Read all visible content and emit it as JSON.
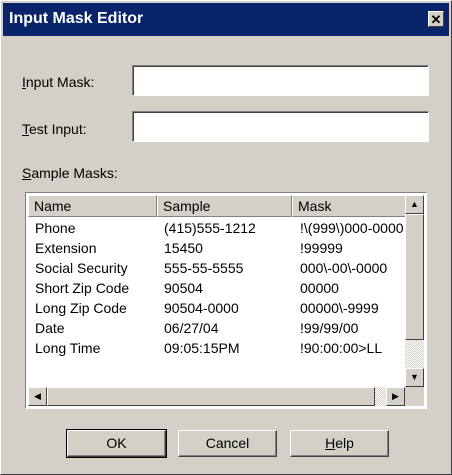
{
  "window": {
    "title": "Input Mask Editor",
    "close_glyph": "✕"
  },
  "form": {
    "input_mask_label_key": "I",
    "input_mask_label_rest": "nput Mask:",
    "input_mask_value": "",
    "test_input_label_key": "T",
    "test_input_label_rest": "est Input:",
    "test_input_value": "",
    "sample_masks_label_key": "S",
    "sample_masks_label_rest": "ample Masks:"
  },
  "table": {
    "columns": [
      "Name",
      "Sample",
      "Mask"
    ],
    "rows": [
      [
        "Phone",
        "(415)555-1212",
        "!\\(999\\)000-0000"
      ],
      [
        "Extension",
        "15450",
        "!99999"
      ],
      [
        "Social Security",
        "555-55-5555",
        "000\\-00\\-0000"
      ],
      [
        "Short Zip Code",
        "90504",
        "00000"
      ],
      [
        "Long Zip Code",
        "90504-0000",
        "00000\\-9999"
      ],
      [
        "Date",
        "06/27/04",
        "!99/99/00"
      ],
      [
        "Long Time",
        "09:05:15PM",
        "!90:00:00>LL"
      ]
    ]
  },
  "buttons": {
    "ok": "OK",
    "cancel": "Cancel",
    "help_key": "H",
    "help_rest": "elp"
  },
  "icons": {
    "scroll_up": "▲",
    "scroll_down": "▼",
    "scroll_left": "◀",
    "scroll_right": "▶"
  }
}
